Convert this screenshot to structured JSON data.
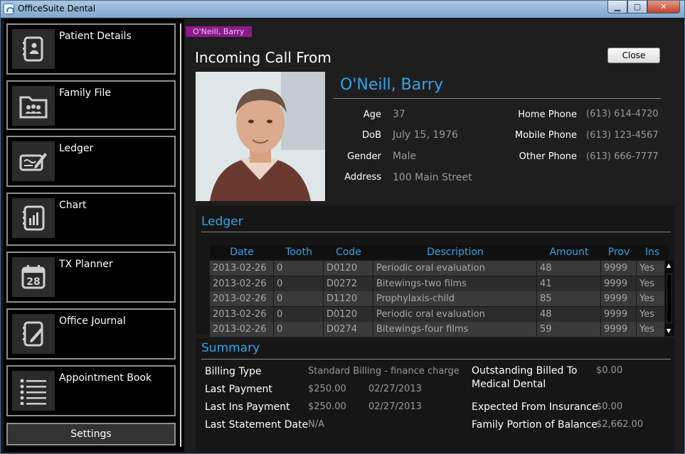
{
  "window": {
    "title": "OfficeSuite Dental"
  },
  "sidebar": {
    "items": [
      {
        "label": "Patient Details",
        "icon": "patient-details-icon"
      },
      {
        "label": "Family File",
        "icon": "family-file-icon"
      },
      {
        "label": "Ledger",
        "icon": "ledger-icon"
      },
      {
        "label": "Chart",
        "icon": "chart-icon"
      },
      {
        "label": "TX Planner",
        "icon": "calendar-icon",
        "icon_text": "28"
      },
      {
        "label": "Office Journal",
        "icon": "journal-icon"
      },
      {
        "label": "Appointment Book",
        "icon": "list-icon"
      }
    ],
    "settings_label": "Settings"
  },
  "header": {
    "badge": "O'Neill, Barry",
    "incoming": "Incoming Call From",
    "close_label": "Close"
  },
  "patient": {
    "name": "O'Neill, Barry",
    "age_label": "Age",
    "age": "37",
    "dob_label": "DoB",
    "dob": "July 15, 1976",
    "gender_label": "Gender",
    "gender": "Male",
    "address_label": "Address",
    "address": "100 Main Street",
    "home_label": "Home Phone",
    "home": "(613) 614-4720",
    "mobile_label": "Mobile Phone",
    "mobile": "(613) 123-4567",
    "other_label": "Other Phone",
    "other": "(613) 666-7777"
  },
  "ledger": {
    "title": "Ledger",
    "columns": [
      "Date",
      "Tooth",
      "Code",
      "Description",
      "Amount",
      "Prov",
      "Ins"
    ],
    "rows": [
      [
        "2013-02-26",
        "0",
        "D0120",
        "Periodic oral evaluation",
        "48",
        "9999",
        "Yes"
      ],
      [
        "2013-02-26",
        "0",
        "D0272",
        "Bitewings-two films",
        "41",
        "9999",
        "Yes"
      ],
      [
        "2013-02-26",
        "0",
        "D1120",
        "Prophylaxis-child",
        "85",
        "9999",
        "Yes"
      ],
      [
        "2013-02-26",
        "0",
        "D0120",
        "Periodic oral evaluation",
        "48",
        "9999",
        "Yes"
      ],
      [
        "2013-02-26",
        "0",
        "D0274",
        "Bitewings-four films",
        "59",
        "9999",
        "Yes"
      ]
    ]
  },
  "summary": {
    "title": "Summary",
    "billing_type_label": "Billing Type",
    "billing_type": "Standard Billing - finance charge",
    "last_payment_label": "Last Payment",
    "last_payment": "$250.00",
    "last_payment_date": "02/27/2013",
    "last_ins_label": "Last Ins Payment",
    "last_ins": "$250.00",
    "last_ins_date": "02/27/2013",
    "last_stmt_label": "Last Statement Date",
    "last_stmt": "N/A",
    "outstanding_label_1": "Outstanding Billed To",
    "outstanding_label_2": "Medical Dental",
    "outstanding": "$0.00",
    "expected_label": "Expected From Insurance",
    "expected": "$0.00",
    "family_label": "Family Portion of Balance",
    "family": "$2,662.00"
  },
  "colors": {
    "accent": "#2fa6ea",
    "badge": "#8c1a8c"
  }
}
